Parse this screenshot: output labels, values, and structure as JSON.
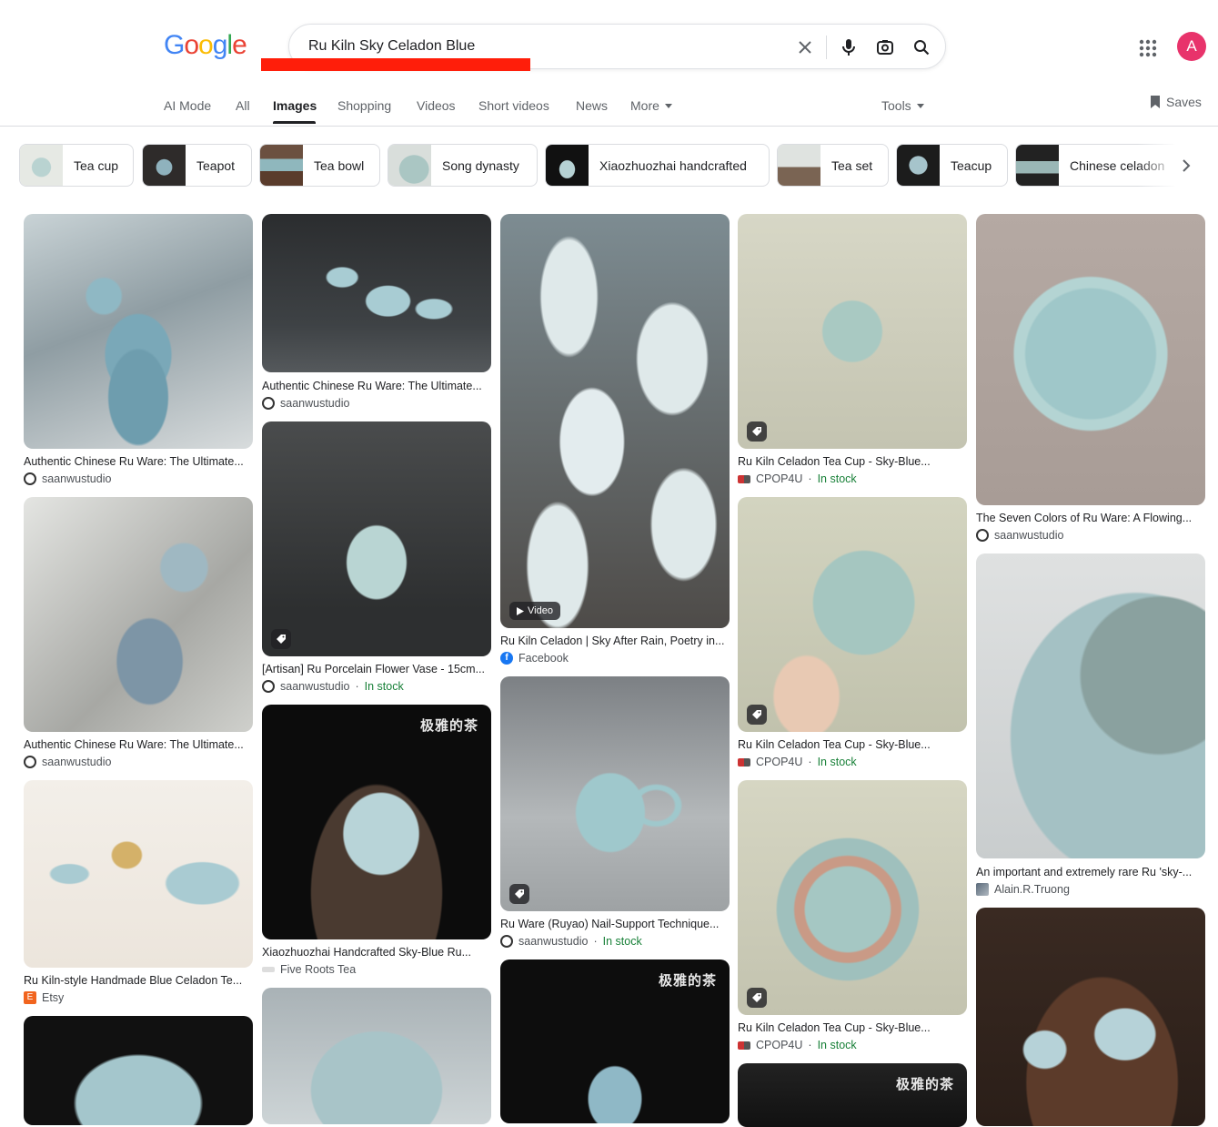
{
  "logo": [
    "G",
    "o",
    "o",
    "g",
    "l",
    "e"
  ],
  "logo_colors": [
    "#4285f4",
    "#ea4335",
    "#fbbc05",
    "#4285f4",
    "#34a853",
    "#ea4335"
  ],
  "search": {
    "query": "Ru Kiln Sky Celadon Blue"
  },
  "avatar_letter": "A",
  "tabs": [
    "AI Mode",
    "All",
    "Images",
    "Shopping",
    "Videos",
    "Short videos",
    "News",
    "More"
  ],
  "tools_label": "Tools",
  "saves_label": "Saves",
  "chips": [
    "Tea cup",
    "Teapot",
    "Tea bowl",
    "Song dynasty",
    "Xiaozhuozhai handcrafted",
    "Tea set",
    "Teacup",
    "Chinese celadon"
  ],
  "results": [
    {
      "title": "Authentic Chinese Ru Ware: The Ultimate...",
      "source": "saanwustudio",
      "stock": ""
    },
    {
      "title": "Authentic Chinese Ru Ware: The Ultimate...",
      "source": "saanwustudio",
      "stock": ""
    },
    {
      "title": "Ru Kiln-style Handmade Blue Celadon Te...",
      "source": "Etsy",
      "stock": ""
    },
    {
      "title": "Authentic Chinese Ru Ware: The Ultimate...",
      "source": "saanwustudio",
      "stock": ""
    },
    {
      "title": "[Artisan] Ru Porcelain Flower Vase - 15cm...",
      "source": "saanwustudio",
      "stock": "In stock"
    },
    {
      "title": "Xiaozhuozhai Handcrafted Sky-Blue Ru...",
      "source": "Five Roots Tea",
      "stock": ""
    },
    {
      "title": "Ru Kiln Celadon | Sky After Rain, Poetry in...",
      "source": "Facebook",
      "stock": ""
    },
    {
      "title": "Ru Ware (Ruyao) Nail-Support Technique...",
      "source": "saanwustudio",
      "stock": "In stock"
    },
    {
      "title": "Ru Kiln Celadon Tea Cup - Sky-Blue...",
      "source": "CPOP4U",
      "stock": "In stock"
    },
    {
      "title": "Ru Kiln Celadon Tea Cup - Sky-Blue...",
      "source": "CPOP4U",
      "stock": "In stock"
    },
    {
      "title": "Ru Kiln Celadon Tea Cup - Sky-Blue...",
      "source": "CPOP4U",
      "stock": "In stock"
    },
    {
      "title": "The Seven Colors of Ru Ware: A Flowing...",
      "source": "saanwustudio",
      "stock": ""
    },
    {
      "title": "An important and extremely rare Ru 'sky-...",
      "source": "Alain.R.Truong",
      "stock": ""
    }
  ],
  "video_label": "Video",
  "stock_sep": " · ",
  "watermark": "极雅的茶",
  "colors": {
    "accent": "#1a73e8",
    "in_stock": "#188038",
    "celadon": "#9fc3c8",
    "redmark": "#ff1e0a"
  }
}
